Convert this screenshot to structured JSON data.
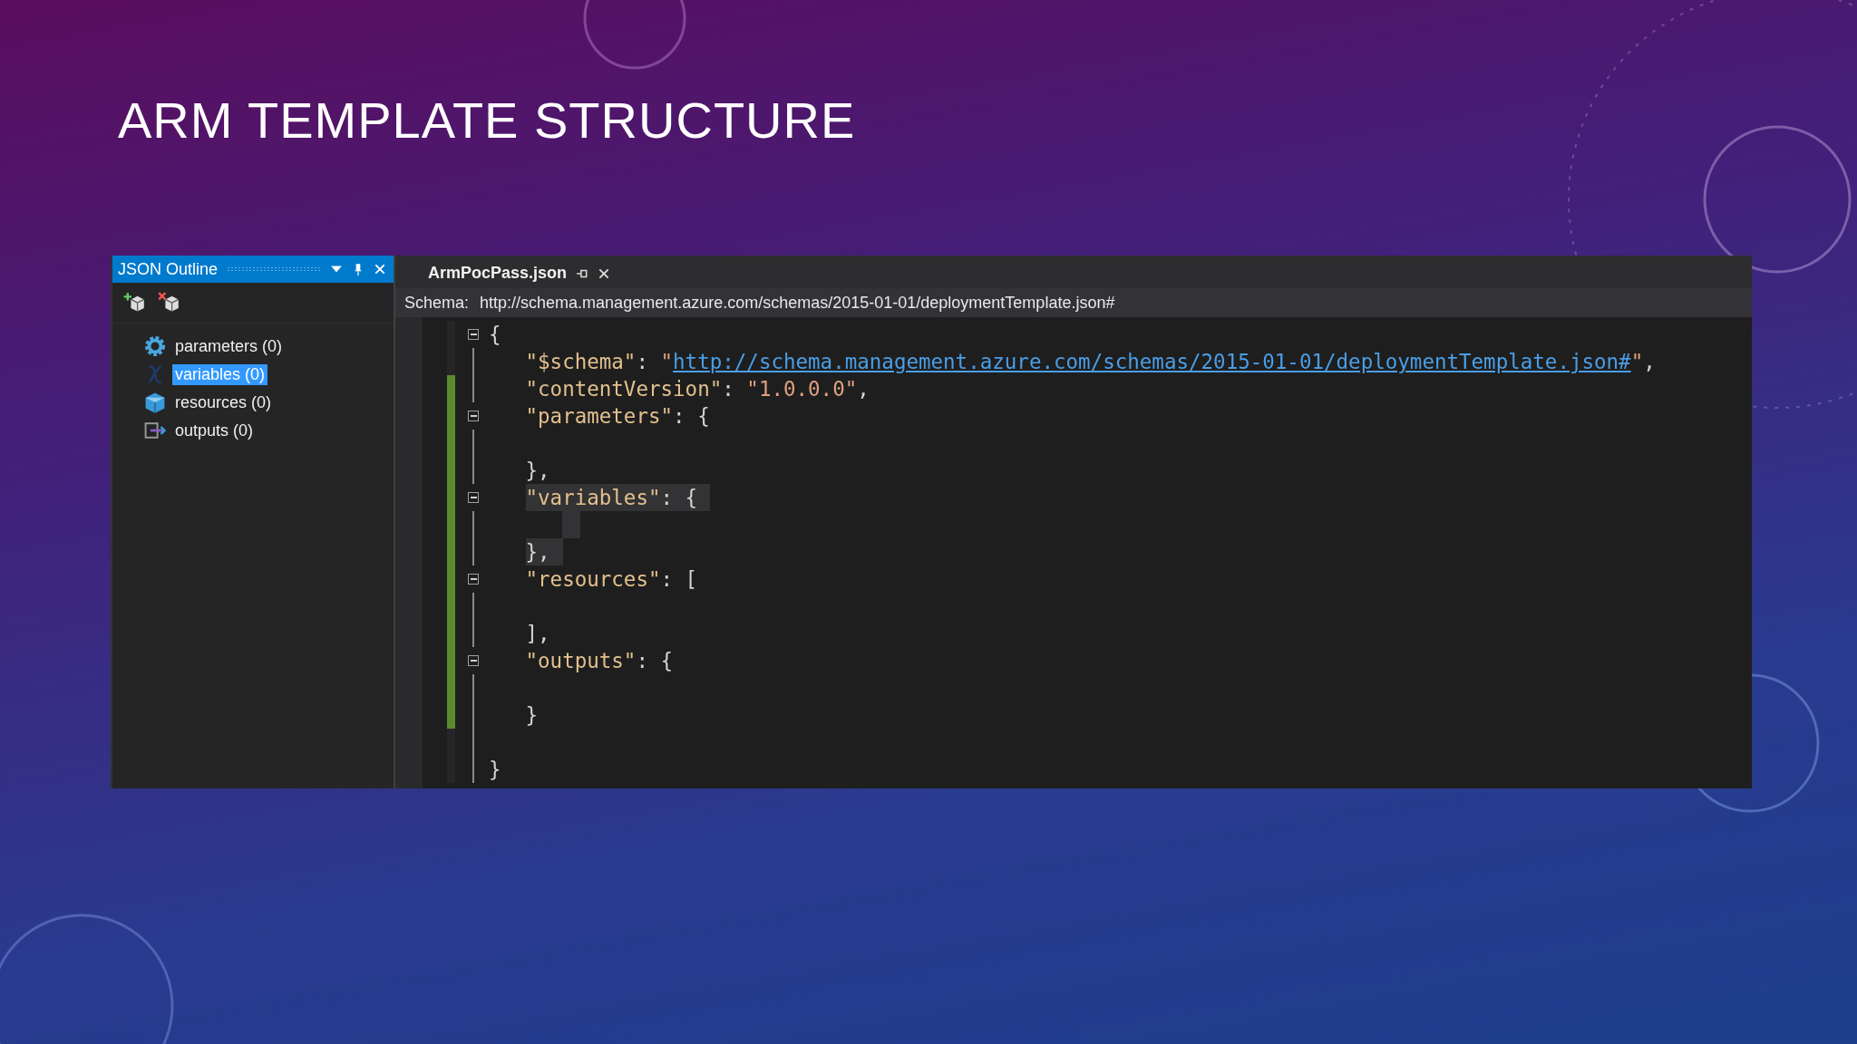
{
  "slide": {
    "title": "ARM TEMPLATE STRUCTURE"
  },
  "outline": {
    "title": "JSON Outline",
    "items": [
      {
        "label": "parameters (0)",
        "kind": "gear",
        "selected": false
      },
      {
        "label": "variables (0)",
        "kind": "variable",
        "selected": true
      },
      {
        "label": "resources (0)",
        "kind": "cube",
        "selected": false
      },
      {
        "label": "outputs (0)",
        "kind": "output",
        "selected": false
      }
    ]
  },
  "editor": {
    "tab": {
      "label": "ArmPocPass.json"
    },
    "schema_label": "Schema:",
    "schema_url": "http://schema.management.azure.com/schemas/2015-01-01/deploymentTemplate.json#",
    "lines": [
      {
        "fold": true,
        "modified": false,
        "highlighted": false,
        "tokens": [
          {
            "kind": "punct",
            "text": "{"
          }
        ],
        "children": [
          {
            "fold": false,
            "modified": false,
            "highlighted": false,
            "tokens": [
              {
                "kind": "key",
                "text": "\"$schema\""
              },
              {
                "kind": "punct",
                "text": ": "
              },
              {
                "kind": "string",
                "text": "\""
              },
              {
                "kind": "link",
                "text": "http://schema.management.azure.com/schemas/2015-01-01/deploymentTemplate.json#"
              },
              {
                "kind": "string",
                "text": "\""
              },
              {
                "kind": "punct",
                "text": ","
              }
            ]
          },
          {
            "fold": false,
            "modified": true,
            "highlighted": false,
            "tokens": [
              {
                "kind": "key",
                "text": "\"contentVersion\""
              },
              {
                "kind": "punct",
                "text": ": "
              },
              {
                "kind": "string",
                "text": "\"1.0.0.0\""
              },
              {
                "kind": "punct",
                "text": ","
              }
            ]
          },
          {
            "fold": true,
            "modified": true,
            "highlighted": false,
            "tokens": [
              {
                "kind": "key",
                "text": "\"parameters\""
              },
              {
                "kind": "punct",
                "text": ": {"
              }
            ],
            "children": [
              {
                "modified": true,
                "highlighted": false
              }
            ]
          },
          {
            "fold": false,
            "modified": true,
            "highlighted": false,
            "tokens": [
              {
                "kind": "punct",
                "text": "},"
              }
            ]
          },
          {
            "fold": true,
            "modified": true,
            "highlighted": true,
            "tokens": [
              {
                "kind": "key",
                "text": "\"variables\""
              },
              {
                "kind": "punct",
                "text": ": {"
              }
            ],
            "children": [
              {
                "modified": true,
                "highlighted": true
              }
            ]
          },
          {
            "fold": false,
            "modified": true,
            "highlighted": true,
            "tokens": [
              {
                "kind": "punct",
                "text": "},"
              }
            ]
          },
          {
            "fold": true,
            "modified": true,
            "highlighted": false,
            "tokens": [
              {
                "kind": "key",
                "text": "\"resources\""
              },
              {
                "kind": "punct",
                "text": ": ["
              }
            ],
            "children": [
              {
                "modified": true,
                "highlighted": false
              }
            ]
          },
          {
            "fold": false,
            "modified": true,
            "highlighted": false,
            "tokens": [
              {
                "kind": "punct",
                "text": "],"
              }
            ]
          },
          {
            "fold": true,
            "modified": true,
            "highlighted": false,
            "tokens": [
              {
                "kind": "key",
                "text": "\"outputs\""
              },
              {
                "kind": "punct",
                "text": ": {"
              }
            ],
            "children": [
              {
                "modified": true,
                "highlighted": false
              }
            ]
          },
          {
            "fold": false,
            "modified": true,
            "highlighted": false,
            "tokens": [
              {
                "kind": "punct",
                "text": "}"
              }
            ]
          },
          {
            "modified": false,
            "highlighted": false
          }
        ]
      },
      {
        "fold": false,
        "modified": false,
        "highlighted": false,
        "tokens": [
          {
            "kind": "punct",
            "text": "}"
          }
        ]
      }
    ]
  }
}
